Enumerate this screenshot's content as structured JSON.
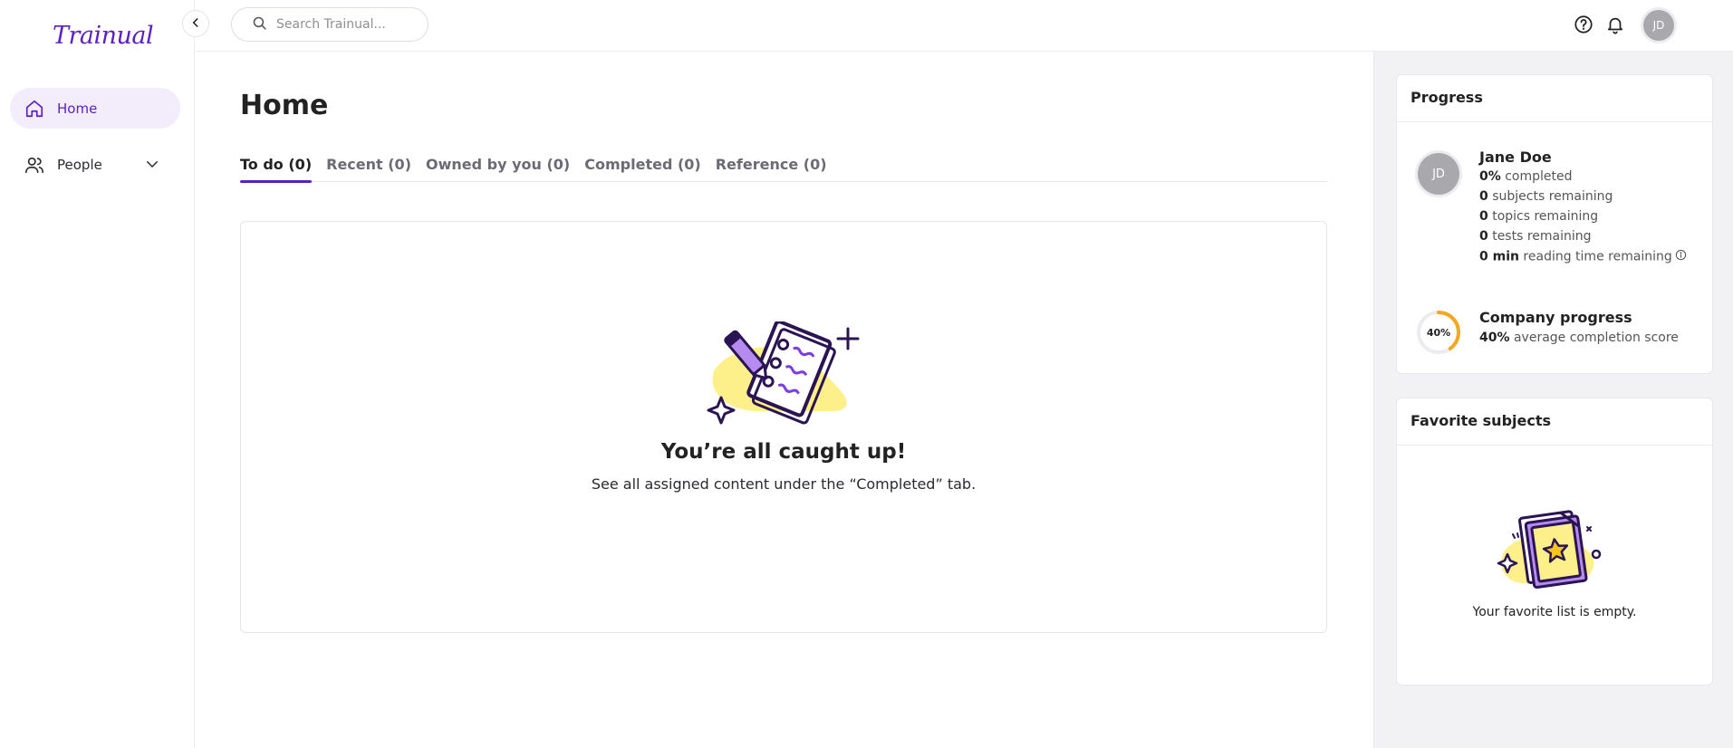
{
  "brand": {
    "logo_text": "Trainual",
    "accent": "#5a1fc7"
  },
  "sidebar": {
    "items": [
      {
        "label": "Home",
        "icon": "home-icon",
        "active": true
      },
      {
        "label": "People",
        "icon": "people-icon",
        "active": false,
        "expandable": true
      }
    ]
  },
  "topbar": {
    "search_placeholder": "Search Trainual...",
    "help_icon": "help-icon",
    "bell_icon": "bell-icon",
    "avatar_initials": "JD"
  },
  "main": {
    "title": "Home",
    "tabs": [
      {
        "label": "To do (0)",
        "active": true
      },
      {
        "label": "Recent (0)",
        "active": false
      },
      {
        "label": "Owned by you (0)",
        "active": false
      },
      {
        "label": "Completed (0)",
        "active": false
      },
      {
        "label": "Reference (0)",
        "active": false
      }
    ],
    "empty_title": "You’re all caught up!",
    "empty_subtitle": "See all assigned content under the “Completed” tab."
  },
  "progress": {
    "heading": "Progress",
    "avatar_initials": "JD",
    "name": "Jane Doe",
    "stats": [
      {
        "value": "0%",
        "label": "completed"
      },
      {
        "value": "0",
        "label": "subjects remaining"
      },
      {
        "value": "0",
        "label": "topics remaining"
      },
      {
        "value": "0",
        "label": "tests remaining"
      },
      {
        "value": "0 min",
        "label": "reading time remaining"
      }
    ],
    "company": {
      "title": "Company progress",
      "ring_label": "40%",
      "ring_fraction": 0.4,
      "ring_color": "#f5a623",
      "value": "40%",
      "label": "average completion score"
    }
  },
  "favorites": {
    "heading": "Favorite subjects",
    "empty_text": "Your favorite list is empty."
  }
}
